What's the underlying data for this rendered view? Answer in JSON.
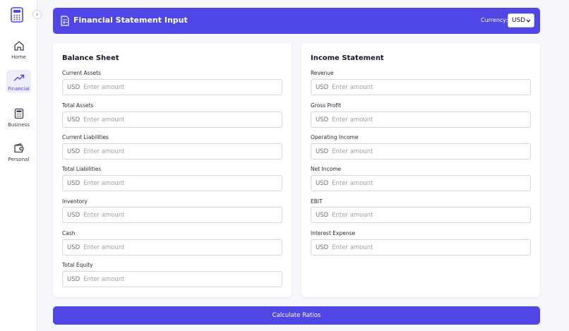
{
  "sidebar": {
    "items": [
      {
        "label": "Home",
        "icon": "home-icon"
      },
      {
        "label": "Financial",
        "icon": "trending-up-icon",
        "active": true
      },
      {
        "label": "Business",
        "icon": "calculator-icon"
      },
      {
        "label": "Personal",
        "icon": "wallet-icon"
      }
    ],
    "collapse_glyph": "›"
  },
  "header": {
    "title": "Financial Statement Input",
    "currency_label": "Currency:",
    "currency_value": "USD"
  },
  "balance_sheet": {
    "title": "Balance Sheet",
    "fields": [
      {
        "label": "Current Assets",
        "prefix": "USD",
        "placeholder": "Enter amount"
      },
      {
        "label": "Total Assets",
        "prefix": "USD",
        "placeholder": "Enter amount"
      },
      {
        "label": "Current Liabilities",
        "prefix": "USD",
        "placeholder": "Enter amount"
      },
      {
        "label": "Total Liabilities",
        "prefix": "USD",
        "placeholder": "Enter amount"
      },
      {
        "label": "Inventory",
        "prefix": "USD",
        "placeholder": "Enter amount"
      },
      {
        "label": "Cash",
        "prefix": "USD",
        "placeholder": "Enter amount"
      },
      {
        "label": "Total Equity",
        "prefix": "USD",
        "placeholder": "Enter amount"
      }
    ]
  },
  "income_statement": {
    "title": "Income Statement",
    "fields": [
      {
        "label": "Revenue",
        "prefix": "USD",
        "placeholder": "Enter amount"
      },
      {
        "label": "Gross Profit",
        "prefix": "USD",
        "placeholder": "Enter amount"
      },
      {
        "label": "Operating Income",
        "prefix": "USD",
        "placeholder": "Enter amount"
      },
      {
        "label": "Net Income",
        "prefix": "USD",
        "placeholder": "Enter amount"
      },
      {
        "label": "EBIT",
        "prefix": "USD",
        "placeholder": "Enter amount"
      },
      {
        "label": "Interest Expense",
        "prefix": "USD",
        "placeholder": "Enter amount"
      }
    ]
  },
  "actions": {
    "calculate_label": "Calculate Ratios"
  },
  "colors": {
    "accent": "#4f46e5",
    "active_nav_bg": "#eceefb",
    "page_bg": "#f5f6f9"
  }
}
